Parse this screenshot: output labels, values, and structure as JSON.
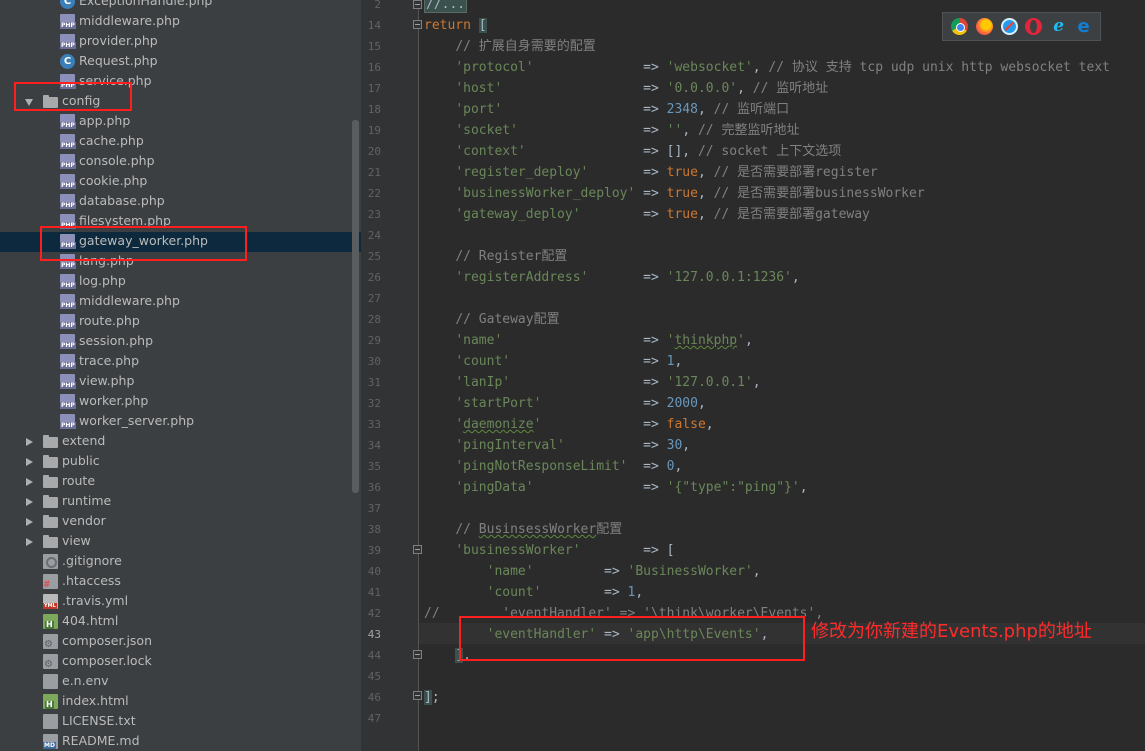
{
  "tree": {
    "items": [
      {
        "label": "ExceptionHandle.php",
        "icon": "class-icon",
        "depth": 2
      },
      {
        "label": "middleware.php",
        "icon": "php-file-icon",
        "depth": 2
      },
      {
        "label": "provider.php",
        "icon": "php-file-icon",
        "depth": 2
      },
      {
        "label": "Request.php",
        "icon": "class-icon",
        "depth": 2
      },
      {
        "label": "service.php",
        "icon": "php-file-icon",
        "depth": 2
      },
      {
        "label": "config",
        "icon": "folder-icon",
        "depth": 1,
        "expanded": true
      },
      {
        "label": "app.php",
        "icon": "php-file-icon",
        "depth": 2
      },
      {
        "label": "cache.php",
        "icon": "php-file-icon",
        "depth": 2
      },
      {
        "label": "console.php",
        "icon": "php-file-icon",
        "depth": 2
      },
      {
        "label": "cookie.php",
        "icon": "php-file-icon",
        "depth": 2
      },
      {
        "label": "database.php",
        "icon": "php-file-icon",
        "depth": 2
      },
      {
        "label": "filesystem.php",
        "icon": "php-file-icon",
        "depth": 2
      },
      {
        "label": "gateway_worker.php",
        "icon": "php-file-icon",
        "depth": 2,
        "selected": true
      },
      {
        "label": "lang.php",
        "icon": "php-file-icon",
        "depth": 2
      },
      {
        "label": "log.php",
        "icon": "php-file-icon",
        "depth": 2
      },
      {
        "label": "middleware.php",
        "icon": "php-file-icon",
        "depth": 2
      },
      {
        "label": "route.php",
        "icon": "php-file-icon",
        "depth": 2
      },
      {
        "label": "session.php",
        "icon": "php-file-icon",
        "depth": 2
      },
      {
        "label": "trace.php",
        "icon": "php-file-icon",
        "depth": 2
      },
      {
        "label": "view.php",
        "icon": "php-file-icon",
        "depth": 2
      },
      {
        "label": "worker.php",
        "icon": "php-file-icon",
        "depth": 2
      },
      {
        "label": "worker_server.php",
        "icon": "php-file-icon",
        "depth": 2
      },
      {
        "label": "extend",
        "icon": "folder-icon",
        "depth": 1,
        "expanded": false
      },
      {
        "label": "public",
        "icon": "folder-icon",
        "depth": 1,
        "expanded": false
      },
      {
        "label": "route",
        "icon": "folder-icon",
        "depth": 1,
        "expanded": false
      },
      {
        "label": "runtime",
        "icon": "folder-icon",
        "depth": 1,
        "expanded": false
      },
      {
        "label": "vendor",
        "icon": "folder-icon",
        "depth": 1,
        "expanded": false
      },
      {
        "label": "view",
        "icon": "folder-icon",
        "depth": 1,
        "expanded": false
      },
      {
        "label": ".gitignore",
        "icon": "git-file-icon",
        "depth": 1
      },
      {
        "label": ".htaccess",
        "icon": "htaccess-file-icon",
        "depth": 1
      },
      {
        "label": ".travis.yml",
        "icon": "yml-file-icon",
        "depth": 1
      },
      {
        "label": "404.html",
        "icon": "html-file-icon",
        "depth": 1
      },
      {
        "label": "composer.json",
        "icon": "config-file-icon",
        "depth": 1
      },
      {
        "label": "composer.lock",
        "icon": "config-file-icon",
        "depth": 1
      },
      {
        "label": "e.n.env",
        "icon": "env-file-icon",
        "depth": 1
      },
      {
        "label": "index.html",
        "icon": "html-file-icon",
        "depth": 1
      },
      {
        "label": "LICENSE.txt",
        "icon": "text-file-icon",
        "depth": 1
      },
      {
        "label": "README.md",
        "icon": "md-file-icon",
        "depth": 1
      }
    ]
  },
  "editor": {
    "line_numbers": [
      "2",
      "14",
      "15",
      "16",
      "17",
      "18",
      "19",
      "20",
      "21",
      "22",
      "23",
      "24",
      "25",
      "26",
      "27",
      "28",
      "29",
      "30",
      "31",
      "32",
      "33",
      "34",
      "35",
      "36",
      "37",
      "38",
      "39",
      "40",
      "41",
      "42",
      "43",
      "44",
      "45",
      "46",
      "47"
    ],
    "current_line": "43",
    "browsers": [
      "chrome-icon",
      "firefox-icon",
      "safari-icon",
      "opera-icon",
      "ie-icon",
      "edge-icon"
    ]
  },
  "annotation": {
    "note": "修改为你新建的Events.php的地址",
    "color": "#ff1f1f"
  },
  "colors": {
    "keyword": "#cc7832",
    "string": "#6a8759",
    "number": "#6897bb",
    "comment": "#808080",
    "text": "#a9b7c6",
    "tree_selection": "#0d293e"
  }
}
